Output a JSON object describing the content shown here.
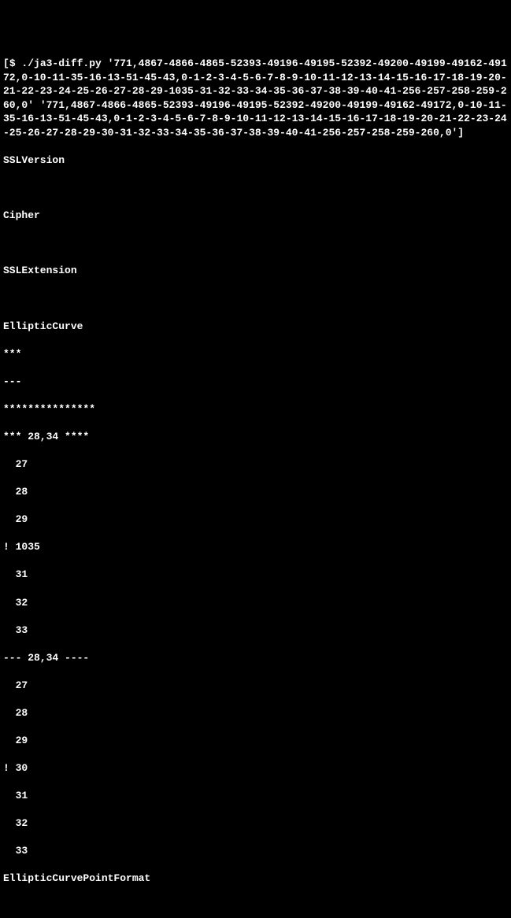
{
  "prompt": {
    "open": "[",
    "ps": "$ ",
    "command": "./ja3-diff.py",
    "arg1": "'771,4867-4866-4865-52393-49196-49195-52392-49200-49199-49162-49172,0-10-11-35-16-13-51-45-43,0-1-2-3-4-5-6-7-8-9-10-11-12-13-14-15-16-17-18-19-20-21-22-23-24-25-26-27-28-29-1035-31-32-33-34-35-36-37-38-39-40-41-256-257-258-259-260,0'",
    "arg2": "'771,4867-4866-4865-52393-49196-49195-52392-49200-49199-49162-49172,0-10-11-35-16-13-51-45-43,0-1-2-3-4-5-6-7-8-9-10-11-12-13-14-15-16-17-18-19-20-21-22-23-24-25-26-27-28-29-30-31-32-33-34-35-36-37-38-39-40-41-256-257-258-259-260,0'",
    "close": "]"
  },
  "out": {
    "l0": "SSLVersion",
    "l1": "",
    "l2": "Cipher",
    "l3": "",
    "l4": "SSLExtension",
    "l5": "",
    "l6": "EllipticCurve",
    "l7": "***",
    "l8": "---",
    "l9": "***************",
    "l10": "*** 28,34 ****",
    "l11": "27",
    "l12": "28",
    "l13": "29",
    "l14": "! 1035",
    "l15": "31",
    "l16": "32",
    "l17": "33",
    "l18": "--- 28,34 ----",
    "l19": "27",
    "l20": "28",
    "l21": "29",
    "l22": "! 30",
    "l23": "31",
    "l24": "32",
    "l25": "33",
    "l26": "EllipticCurvePointFormat"
  }
}
